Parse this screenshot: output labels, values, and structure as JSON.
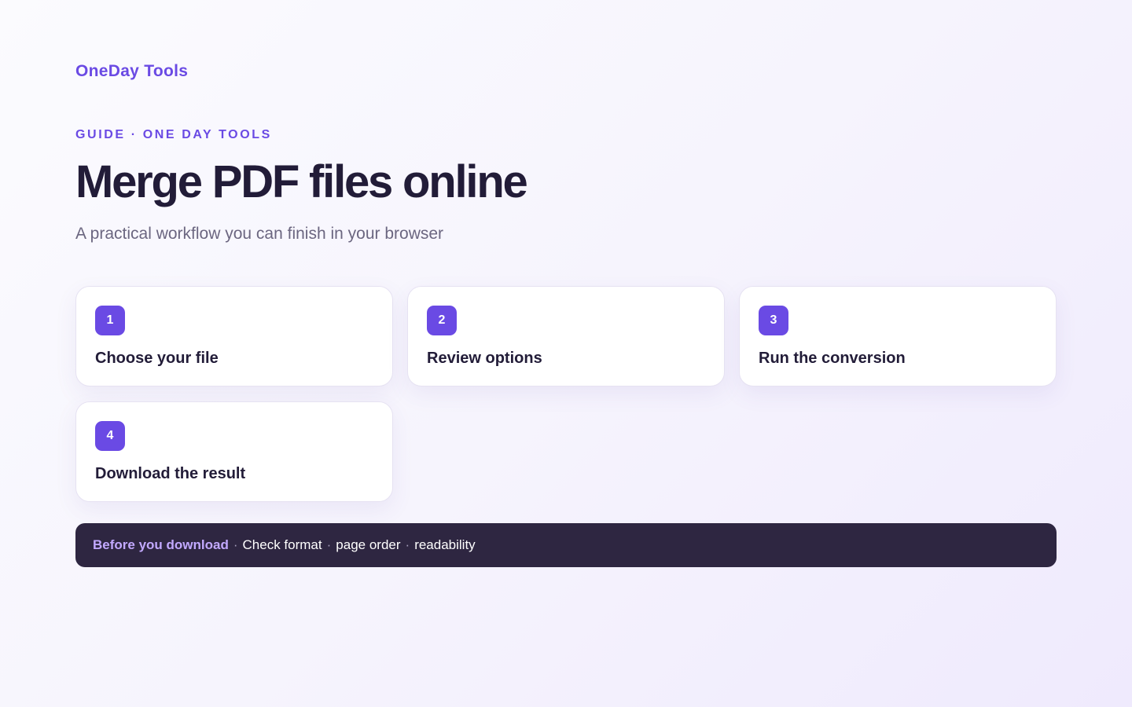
{
  "brand": "OneDay Tools",
  "eyebrow": "GUIDE · ONE DAY TOOLS",
  "title": "Merge PDF files online",
  "subtitle": "A practical workflow you can finish in your browser",
  "steps": [
    {
      "number": "1",
      "label": "Choose your file"
    },
    {
      "number": "2",
      "label": "Review options"
    },
    {
      "number": "3",
      "label": "Run the conversion"
    },
    {
      "number": "4",
      "label": "Download the result"
    }
  ],
  "banner": {
    "lead": "Before you download",
    "separator": "·",
    "items": [
      "Check format",
      "page order",
      "readability"
    ]
  },
  "colors": {
    "accent": "#6a4ae4",
    "banner_bg": "#2e2641",
    "banner_lead": "#c2a9ff",
    "title": "#221c38"
  }
}
